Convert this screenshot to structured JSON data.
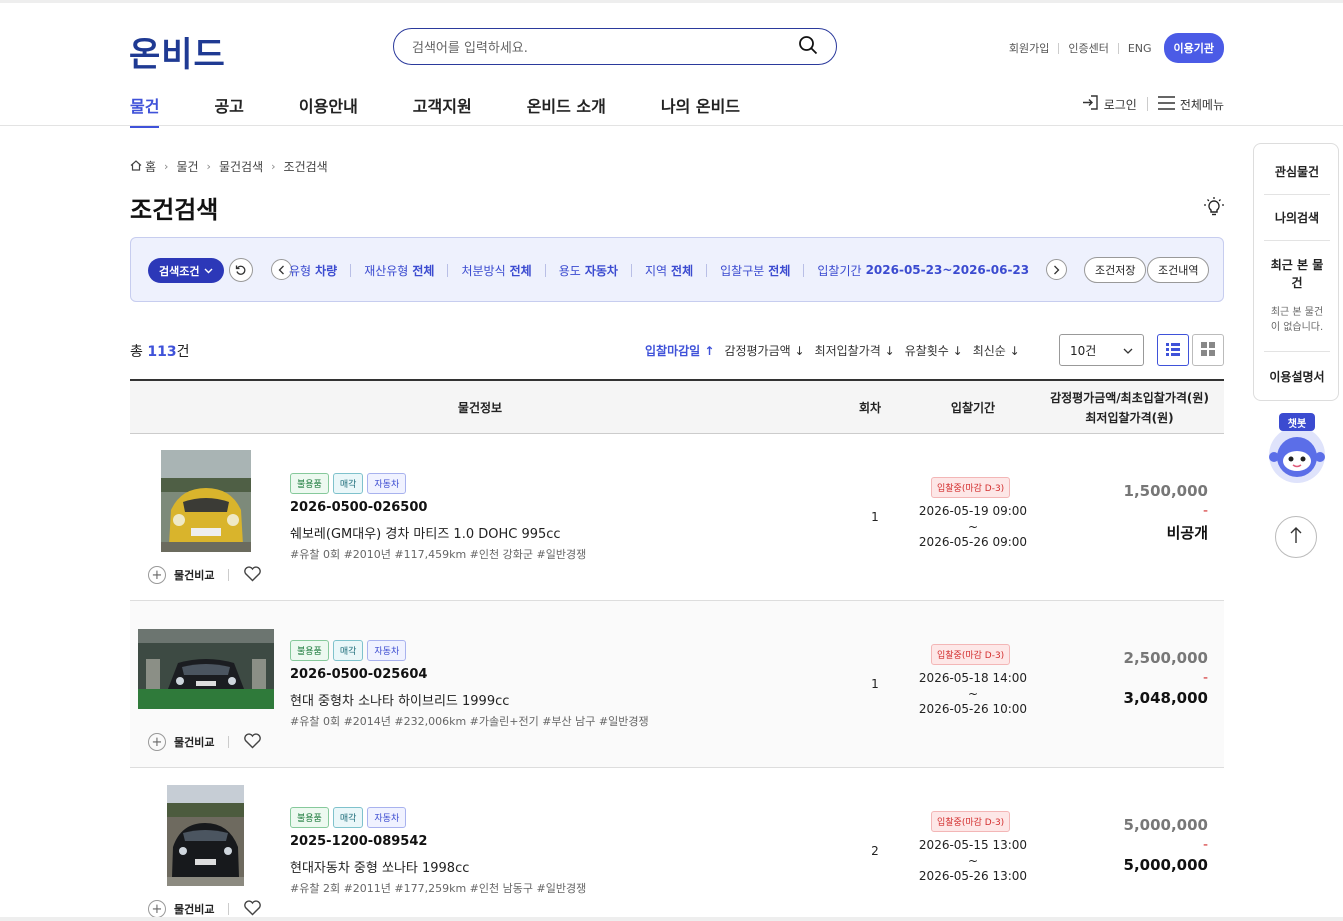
{
  "header": {
    "logo": "온비드",
    "search_placeholder": "검색어를 입력하세요.",
    "util_links": [
      "회원가입",
      "인증센터",
      "ENG"
    ],
    "org_button": "이용기관",
    "nav": [
      "물건",
      "공고",
      "이용안내",
      "고객지원",
      "온비드 소개",
      "나의 온비드"
    ],
    "login": "로그인",
    "all_menu": "전체메뉴"
  },
  "breadcrumb": [
    "홈",
    "물건",
    "물건검색",
    "조건검색"
  ],
  "page_title": "조건검색",
  "conditions": {
    "button": "검색조건",
    "items": [
      {
        "label": "유형",
        "value": "차량"
      },
      {
        "label": "재산유형",
        "value": "전체"
      },
      {
        "label": "처분방식",
        "value": "전체"
      },
      {
        "label": "용도",
        "value": "자동차"
      },
      {
        "label": "지역",
        "value": "전체"
      },
      {
        "label": "입찰구분",
        "value": "전체"
      },
      {
        "label": "입찰기간",
        "value": "2026-05-23~2026-06-23"
      }
    ],
    "save": "조건저장",
    "history": "조건내역"
  },
  "list": {
    "total_prefix": "총",
    "total_count": "113",
    "total_suffix": "건",
    "sorts": [
      "입찰마감일 ↑",
      "감정평가금액 ↓",
      "최저입찰가격 ↓",
      "유찰횟수 ↓",
      "최신순 ↓"
    ],
    "page_size": "10건",
    "columns": {
      "info": "물건정보",
      "round": "회차",
      "period": "입찰기간",
      "price_line1": "감정평가금액/최초입찰가격(원)",
      "price_line2": "최저입찰가격(원)"
    },
    "compare_label": "물건비교",
    "rows": [
      {
        "tags": [
          "불용품",
          "매각",
          "자동차"
        ],
        "number": "2026-0500-026500",
        "name": "쉐보레(GM대우) 경차 마티즈 1.0 DOHC 995cc",
        "meta": "#유찰 0회  #2010년  #117,459km  #인천 강화군  #일반경쟁",
        "round": "1",
        "status": "입찰중(마감 D-3)",
        "start": "2026-05-19 09:00",
        "tilde": "~",
        "end": "2026-05-26 09:00",
        "appraisal": "1,500,000",
        "dash": "-",
        "min_price": "비공개"
      },
      {
        "tags": [
          "불용품",
          "매각",
          "자동차"
        ],
        "number": "2026-0500-025604",
        "name": "현대 중형차 소나타 하이브리드 1999cc",
        "meta": "#유찰 0회  #2014년  #232,006km  #가솔린+전기  #부산 남구  #일반경쟁",
        "round": "1",
        "status": "입찰중(마감 D-3)",
        "start": "2026-05-18 14:00",
        "tilde": "~",
        "end": "2026-05-26 10:00",
        "appraisal": "2,500,000",
        "dash": "-",
        "min_price": "3,048,000"
      },
      {
        "tags": [
          "불용품",
          "매각",
          "자동차"
        ],
        "number": "2025-1200-089542",
        "name": "현대자동차 중형 쏘나타 1998cc",
        "meta": "#유찰 2회  #2011년  #177,259km  #인천 남동구  #일반경쟁",
        "round": "2",
        "status": "입찰중(마감 D-3)",
        "start": "2026-05-15 13:00",
        "tilde": "~",
        "end": "2026-05-26 13:00",
        "appraisal": "5,000,000",
        "dash": "-",
        "min_price": "5,000,000"
      }
    ]
  },
  "sidebar": {
    "items": [
      "관심물건",
      "나의검색"
    ],
    "recent_title_1": "최근 본 물",
    "recent_title_2": "건",
    "recent_empty_1": "최근 본 물건",
    "recent_empty_2": "이 없습니다.",
    "manual": "이용설명서",
    "chatbot": "챗봇"
  },
  "colors": {
    "accent": "#3f52d9",
    "navy": "#2c38b8",
    "danger": "#d32f2f"
  }
}
